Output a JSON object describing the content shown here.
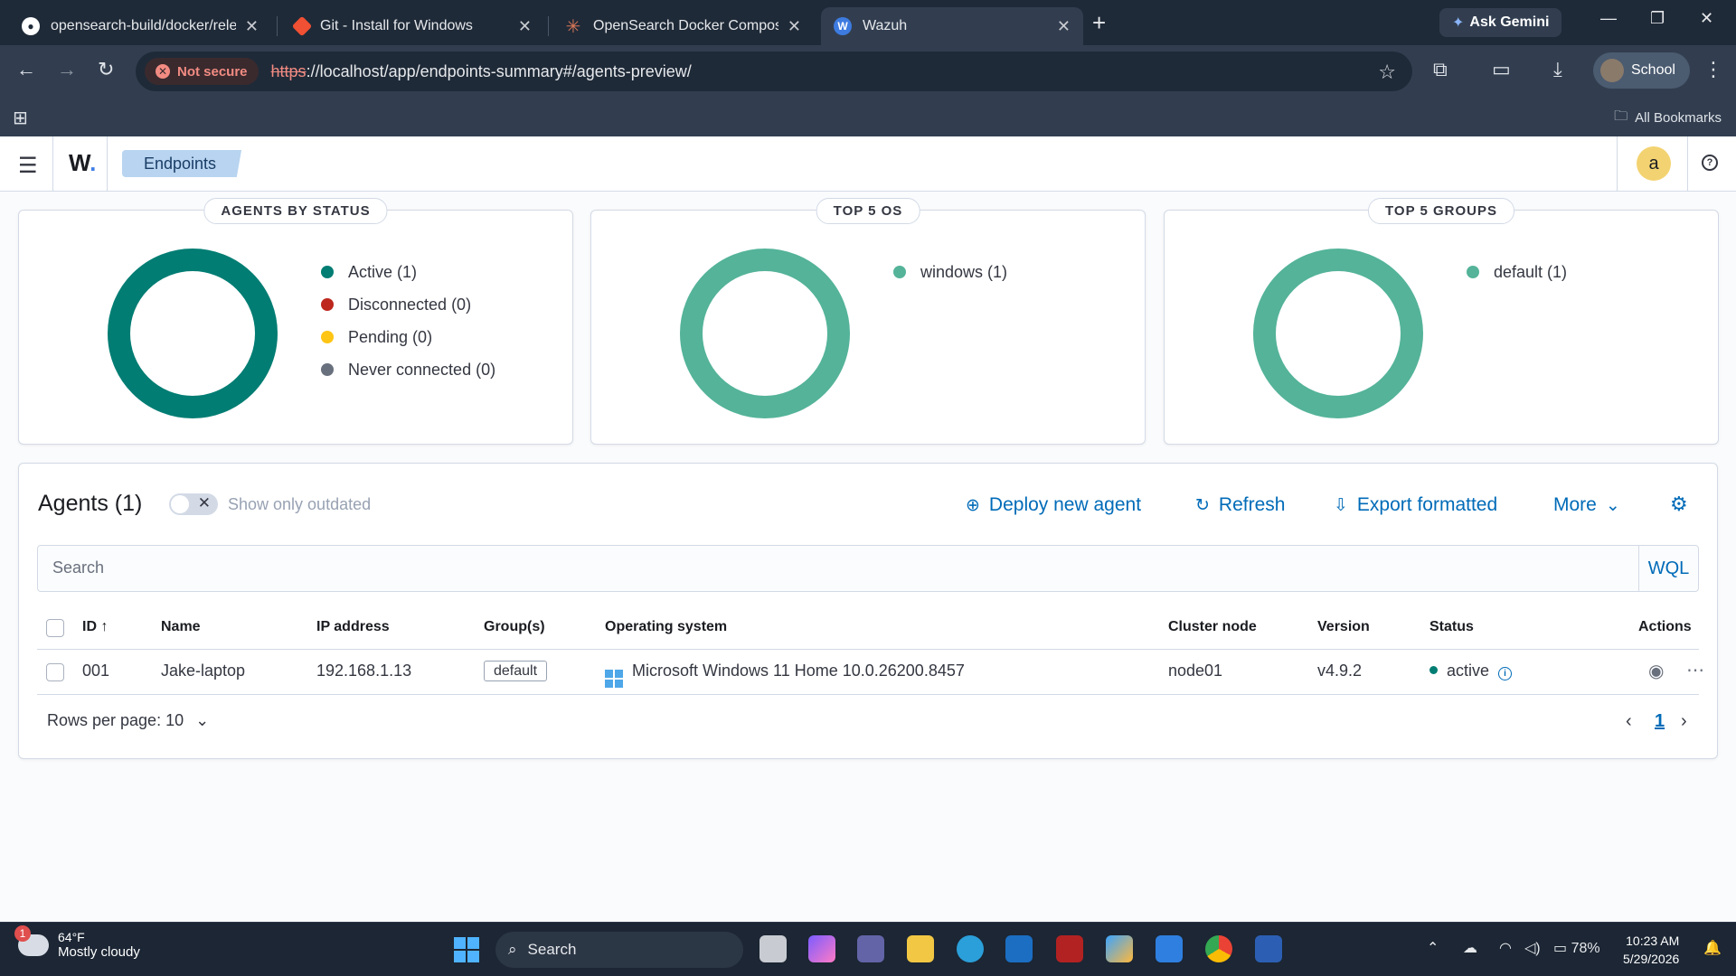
{
  "browser": {
    "tabs": [
      {
        "title": "opensearch-build/docker/release",
        "favicon": "github-icon"
      },
      {
        "title": "Git - Install for Windows",
        "favicon": "git-icon"
      },
      {
        "title": "OpenSearch Docker Compose",
        "favicon": "claude-icon"
      },
      {
        "title": "Wazuh",
        "favicon": "wazuh-icon",
        "active": true
      }
    ],
    "ask_gemini": "Ask Gemini",
    "security_label": "Not secure",
    "url_scheme": "https",
    "url_rest": "://localhost/app/endpoints-summary#/agents-preview/",
    "profile_label": "School",
    "all_bookmarks": "All Bookmarks"
  },
  "app": {
    "logo": "W",
    "breadcrumb": "Endpoints",
    "user_initial": "a"
  },
  "panels": {
    "status": {
      "title": "AGENTS BY STATUS",
      "legend": [
        {
          "label": "Active (1)",
          "color": "#017d73"
        },
        {
          "label": "Disconnected (0)",
          "color": "#bd271e"
        },
        {
          "label": "Pending (0)",
          "color": "#fec514"
        },
        {
          "label": "Never connected (0)",
          "color": "#69707d"
        }
      ]
    },
    "os": {
      "title": "TOP 5 OS",
      "legend": [
        {
          "label": "windows (1)",
          "color": "#54b399"
        }
      ]
    },
    "groups": {
      "title": "TOP 5 GROUPS",
      "legend": [
        {
          "label": "default (1)",
          "color": "#54b399"
        }
      ]
    }
  },
  "agents": {
    "title": "Agents (1)",
    "toggle_label": "Show only outdated",
    "actions": {
      "deploy": "Deploy new agent",
      "refresh": "Refresh",
      "export": "Export formatted",
      "more": "More"
    },
    "search_placeholder": "Search",
    "wql": "WQL",
    "columns": [
      "ID",
      "Name",
      "IP address",
      "Group(s)",
      "Operating system",
      "Cluster node",
      "Version",
      "Status",
      "Actions"
    ],
    "rows": [
      {
        "id": "001",
        "name": "Jake-laptop",
        "ip": "192.168.1.13",
        "group": "default",
        "os": "Microsoft Windows 11 Home 10.0.26200.8457",
        "node": "node01",
        "version": "v4.9.2",
        "status": "active"
      }
    ],
    "rows_per_page": "Rows per page: 10",
    "current_page": "1"
  },
  "taskbar": {
    "weather_temp": "64°F",
    "weather_desc": "Mostly cloudy",
    "weather_badge": "1",
    "search": "Search",
    "battery": "78%",
    "time": "10:23 AM",
    "date": "5/29/2026"
  }
}
